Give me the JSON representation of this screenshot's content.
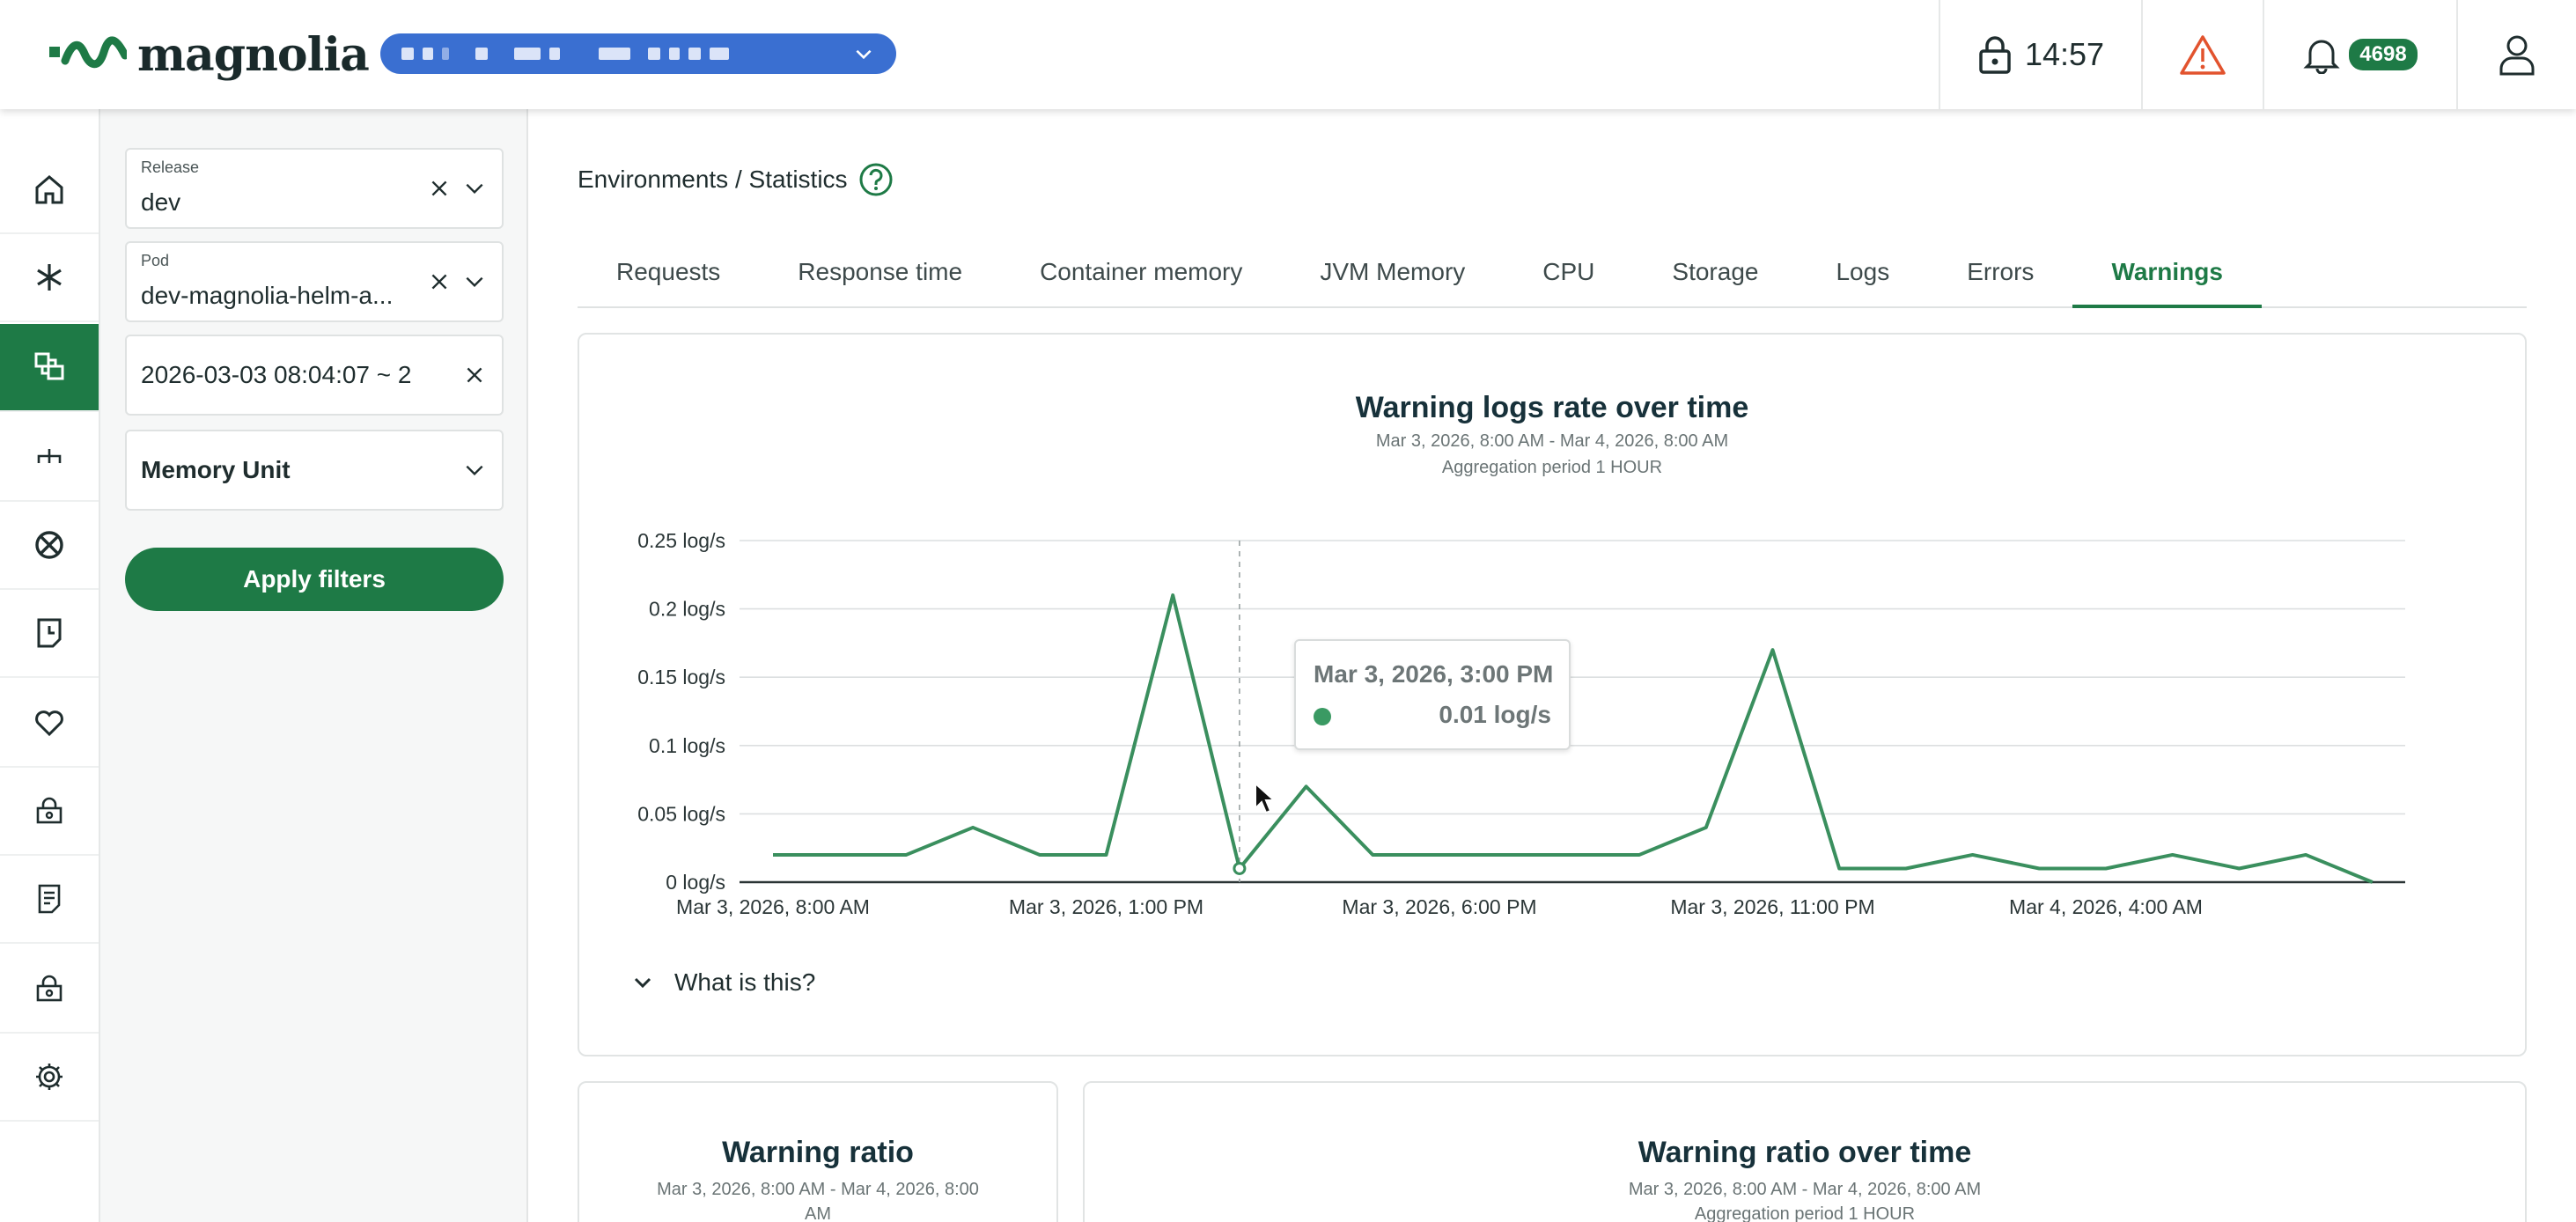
{
  "header": {
    "logo_text": "magnolia",
    "clock": "14:57",
    "notification_count": "4698",
    "colors": {
      "brand": "#1e7a46",
      "env_pill": "#3a6fd1",
      "warning": "#e2532e"
    }
  },
  "rail": {
    "items": [
      {
        "icon": "home-icon"
      },
      {
        "icon": "asterisk-icon"
      },
      {
        "icon": "environments-icon",
        "active": true
      },
      {
        "icon": "hierarchy-icon"
      },
      {
        "icon": "globe-cross-icon"
      },
      {
        "icon": "document-clock-icon"
      },
      {
        "icon": "heart-icon"
      },
      {
        "icon": "lock-box-icon"
      },
      {
        "icon": "notes-icon"
      },
      {
        "icon": "lock-box-icon"
      },
      {
        "icon": "gear-icon"
      }
    ]
  },
  "filters": {
    "release_label": "Release",
    "release_value": "dev",
    "pod_label": "Pod",
    "pod_value": "dev-magnolia-helm-a...",
    "date_value": "2026-03-03 08:04:07 ~ 2",
    "memory_unit": "Memory Unit",
    "apply_label": "Apply filters"
  },
  "breadcrumb": "Environments / Statistics",
  "tabs": [
    {
      "label": "Requests"
    },
    {
      "label": "Response time"
    },
    {
      "label": "Container memory"
    },
    {
      "label": "JVM Memory"
    },
    {
      "label": "CPU"
    },
    {
      "label": "Storage"
    },
    {
      "label": "Logs"
    },
    {
      "label": "Errors"
    },
    {
      "label": "Warnings",
      "active": true
    }
  ],
  "chart_data": {
    "type": "line",
    "title": "Warning logs rate over time",
    "subtitle": "Mar 3, 2026, 8:00 AM - Mar 4, 2026, 8:00 AM",
    "aggregation": "Aggregation period 1 HOUR",
    "xlabel": "",
    "ylabel": "",
    "ylim": [
      0,
      0.25
    ],
    "y_ticks": [
      "0 log/s",
      "0.05 log/s",
      "0.1 log/s",
      "0.15 log/s",
      "0.2 log/s",
      "0.25 log/s"
    ],
    "x_ticks": [
      "Mar 3, 2026, 8:00 AM",
      "Mar 3, 2026, 1:00 PM",
      "Mar 3, 2026, 6:00 PM",
      "Mar 3, 2026, 11:00 PM",
      "Mar 4, 2026, 4:00 AM"
    ],
    "grid": true,
    "line_color": "#3a8f5e",
    "series": [
      {
        "x": [
          "Mar 3, 2026, 8:00 AM",
          "Mar 3, 2026, 9:00 AM",
          "Mar 3, 2026, 10:00 AM",
          "Mar 3, 2026, 11:00 AM",
          "Mar 3, 2026, 12:00 PM",
          "Mar 3, 2026, 1:00 PM",
          "Mar 3, 2026, 2:00 PM",
          "Mar 3, 2026, 3:00 PM",
          "Mar 3, 2026, 4:00 PM",
          "Mar 3, 2026, 5:00 PM",
          "Mar 3, 2026, 6:00 PM",
          "Mar 3, 2026, 7:00 PM",
          "Mar 3, 2026, 8:00 PM",
          "Mar 3, 2026, 9:00 PM",
          "Mar 3, 2026, 10:00 PM",
          "Mar 3, 2026, 11:00 PM",
          "Mar 4, 2026, 12:00 AM",
          "Mar 4, 2026, 1:00 AM",
          "Mar 4, 2026, 2:00 AM",
          "Mar 4, 2026, 3:00 AM",
          "Mar 4, 2026, 4:00 AM",
          "Mar 4, 2026, 5:00 AM",
          "Mar 4, 2026, 6:00 AM",
          "Mar 4, 2026, 7:00 AM",
          "Mar 4, 2026, 8:00 AM"
        ],
        "values": [
          0.02,
          0.02,
          0.02,
          0.04,
          0.02,
          0.02,
          0.21,
          0.01,
          0.07,
          0.02,
          0.02,
          0.02,
          0.02,
          0.02,
          0.04,
          0.17,
          0.01,
          0.01,
          0.02,
          0.01,
          0.01,
          0.02,
          0.01,
          0.02,
          0.0
        ]
      }
    ],
    "tooltip": {
      "title": "Mar 3, 2026, 3:00 PM",
      "value": "0.01 log/s"
    }
  },
  "what_is_this": "What is this?",
  "ratio_card": {
    "title": "Warning ratio",
    "subtitle_1": "Mar 3, 2026, 8:00 AM - Mar 4, 2026, 8:00",
    "subtitle_2": "AM"
  },
  "ratio_time_card": {
    "title": "Warning ratio over time",
    "subtitle": "Mar 3, 2026, 8:00 AM - Mar 4, 2026, 8:00 AM",
    "aggregation": "Aggregation period 1 HOUR"
  }
}
